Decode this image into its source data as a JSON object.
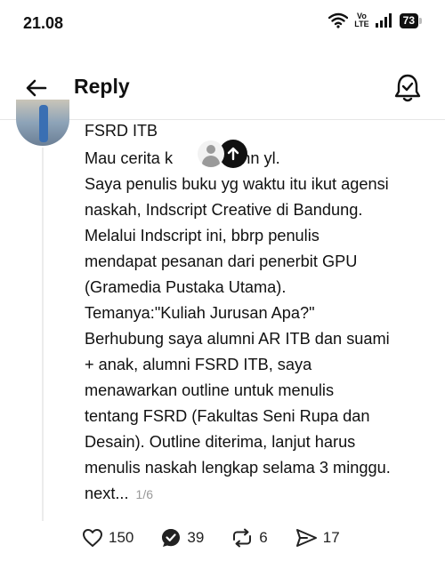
{
  "status_bar": {
    "time": "21.08",
    "volte_top": "Vo",
    "volte_bottom": "LTE",
    "battery": "73"
  },
  "header": {
    "title": "Reply",
    "back_icon": "arrow-left-icon",
    "notification_icon": "bell-check-icon"
  },
  "post": {
    "author": "FSRD ITB",
    "lines": [
      "Mau cerita k",
      "Saya penulis buku yg waktu itu ikut agensi",
      "naskah, Indscript Creative di Bandung.",
      "Melalui Indscript ini,  bbrp penulis",
      "mendapat pesanan dari penerbit GPU",
      "(Gramedia Pustaka Utama).",
      "Temanya:\"Kuliah Jurusan Apa?\"",
      "Berhubung saya alumni AR ITB dan suami",
      "+ anak, alumni FSRD ITB, saya",
      "menawarkan outline untuk menulis",
      "tentang FSRD (Fakultas Seni Rupa dan",
      "Desain). Outline diterima, lanjut harus",
      "menulis naskah lengkap selama 3 minggu.",
      "next..."
    ],
    "first_line_tail": "0thn yl.",
    "page_indicator": "1/6",
    "overlay_icons": [
      "user-silhouette-icon",
      "arrow-up-icon"
    ]
  },
  "actions": {
    "likes": "150",
    "replies": "39",
    "reposts": "6",
    "shares": "17"
  },
  "colors": {
    "text": "#111111",
    "muted": "#999999",
    "divider": "#e6e6e6"
  }
}
